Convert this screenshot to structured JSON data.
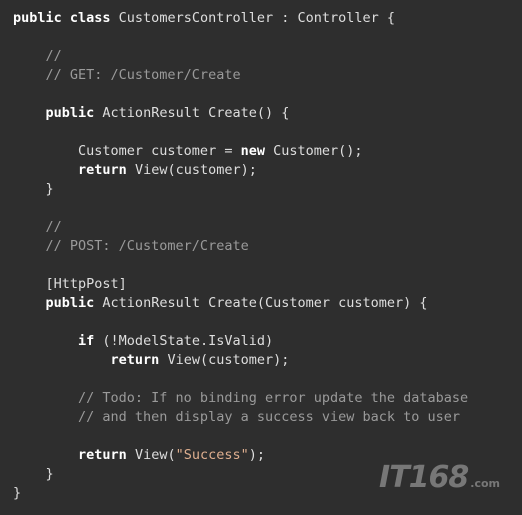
{
  "lines": [
    [
      {
        "t": "public class",
        "c": "kw"
      },
      {
        "t": " CustomersController : Controller {",
        "c": "plain"
      }
    ],
    [],
    [
      {
        "t": "    //",
        "c": "comment"
      }
    ],
    [
      {
        "t": "    // GET: /Customer/Create",
        "c": "comment"
      }
    ],
    [],
    [
      {
        "t": "    ",
        "c": "plain"
      },
      {
        "t": "public",
        "c": "kw"
      },
      {
        "t": " ActionResult Create() {",
        "c": "plain"
      }
    ],
    [],
    [
      {
        "t": "        Customer customer = ",
        "c": "plain"
      },
      {
        "t": "new",
        "c": "kw"
      },
      {
        "t": " Customer();",
        "c": "plain"
      }
    ],
    [
      {
        "t": "        ",
        "c": "plain"
      },
      {
        "t": "return",
        "c": "kw"
      },
      {
        "t": " View(customer);",
        "c": "plain"
      }
    ],
    [
      {
        "t": "    }",
        "c": "plain"
      }
    ],
    [],
    [
      {
        "t": "    //",
        "c": "comment"
      }
    ],
    [
      {
        "t": "    // POST: /Customer/Create",
        "c": "comment"
      }
    ],
    [],
    [
      {
        "t": "    [HttpPost]",
        "c": "attr"
      }
    ],
    [
      {
        "t": "    ",
        "c": "plain"
      },
      {
        "t": "public",
        "c": "kw"
      },
      {
        "t": " ActionResult Create(Customer customer) {",
        "c": "plain"
      }
    ],
    [],
    [
      {
        "t": "        ",
        "c": "plain"
      },
      {
        "t": "if",
        "c": "kw"
      },
      {
        "t": " (!ModelState.IsValid)",
        "c": "plain"
      }
    ],
    [
      {
        "t": "            ",
        "c": "plain"
      },
      {
        "t": "return",
        "c": "kw"
      },
      {
        "t": " View(customer);",
        "c": "plain"
      }
    ],
    [],
    [
      {
        "t": "        // Todo: If no binding error update the database",
        "c": "comment"
      }
    ],
    [
      {
        "t": "        // and then display a success view back to user",
        "c": "comment"
      }
    ],
    [],
    [
      {
        "t": "        ",
        "c": "plain"
      },
      {
        "t": "return",
        "c": "kw"
      },
      {
        "t": " View(",
        "c": "plain"
      },
      {
        "t": "\"Success\"",
        "c": "string"
      },
      {
        "t": ");",
        "c": "plain"
      }
    ],
    [
      {
        "t": "    }",
        "c": "plain"
      }
    ],
    [
      {
        "t": "}",
        "c": "plain"
      }
    ]
  ],
  "colors": {
    "background": "#2e2e2e",
    "keyword": "#ffffff",
    "text": "#dedede",
    "comment": "#9a9a9a",
    "string": "#dfaf8f"
  },
  "watermark": {
    "brand": "IT168",
    "suffix": ".com"
  }
}
